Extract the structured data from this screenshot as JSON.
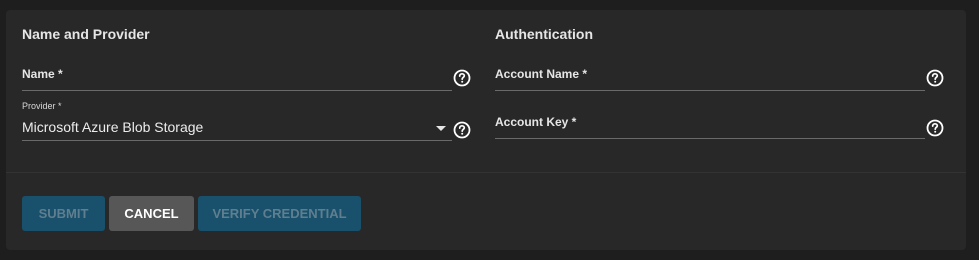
{
  "sections": {
    "left_title": "Name and Provider",
    "right_title": "Authentication"
  },
  "fields": {
    "name": {
      "label": "Name *",
      "value": ""
    },
    "provider": {
      "label": "Provider *",
      "value": "Microsoft Azure Blob Storage"
    },
    "account_name": {
      "label": "Account Name *",
      "value": ""
    },
    "account_key": {
      "label": "Account Key *",
      "value": ""
    }
  },
  "buttons": {
    "submit": "SUBMIT",
    "cancel": "CANCEL",
    "verify": "VERIFY CREDENTIAL"
  },
  "icons": {
    "help": "help-circle-icon",
    "dropdown": "caret-down-icon"
  },
  "colors": {
    "page_bg": "#1e1e1e",
    "card_bg": "#282828",
    "primary_disabled": "#19506b",
    "secondary_button": "#575757"
  }
}
